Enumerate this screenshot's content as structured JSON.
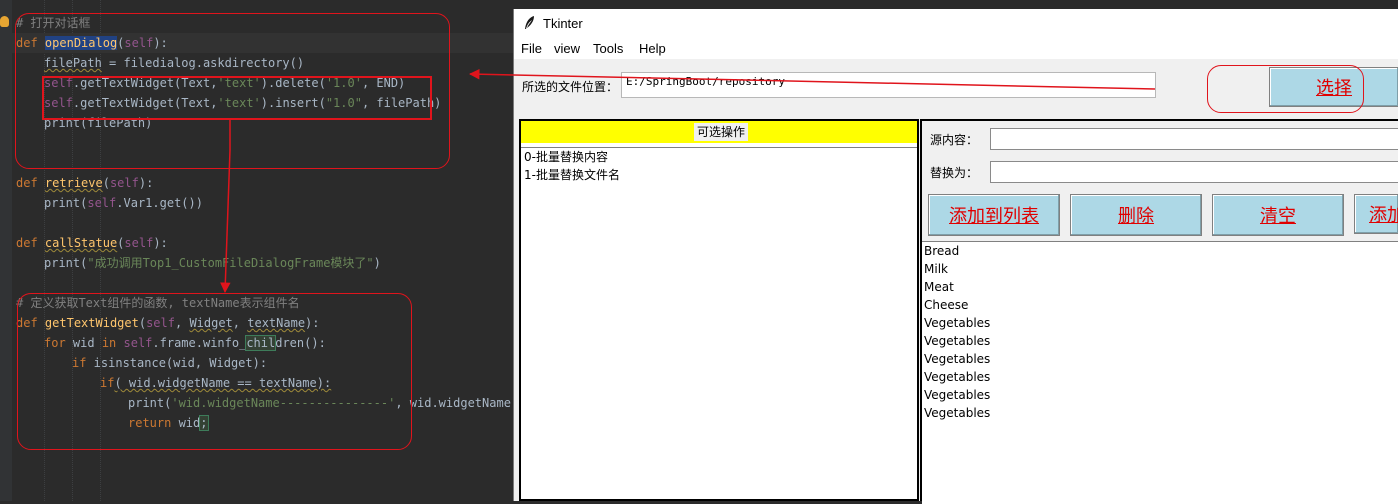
{
  "editor": {
    "lines": {
      "l1": "# 打开对话框",
      "l2_def": "def",
      "l2_name": "openDialog",
      "l2_self": "self",
      "l3_var": "filePath",
      "l3_rest": " = filedialog.askdirectory()",
      "l4_self": "self",
      "l4_a": ".getTextWidget(Text",
      "l4_str": "'text'",
      "l4_b": ").delete(",
      "l4_num": "'1.0'",
      "l4_c": ", END)",
      "l5_self": "self",
      "l5_a": ".getTextWidget(Text",
      "l5_str": "'text'",
      "l5_b": ").insert(",
      "l5_num": "\"1.0\"",
      "l5_c": ", filePath)",
      "l6": "print(filePath)",
      "l7_def": "def",
      "l7_name": "retrieve",
      "l7_self": "self",
      "l8_a": "print(",
      "l8_self": "self",
      "l8_b": ".Var1.get())",
      "l9_def": "def",
      "l9_name": "callStatue",
      "l9_self": "self",
      "l10_a": "print(",
      "l10_str": "\"成功调用Top1_CustomFileDialogFrame模块了\"",
      "l10_b": ")",
      "l11": "# 定义获取Text组件的函数, textName表示组件名",
      "l12_def": "def",
      "l12_name": "getTextWidget",
      "l12_self": "self",
      "l12_mid": ", ",
      "l12_widget": "Widget",
      "l12_sep": ", ",
      "l12_tn": "textName",
      "l12_end": "):",
      "l13_for": "for",
      "l13_a": " wid ",
      "l13_in": "in",
      "l13_self": "self",
      "l13_b": ".frame.winfo_",
      "l13_sel": "chil",
      "l13_c": "dren():",
      "l14_if": "if",
      "l14_a": " isinstance(wid, Widget):",
      "l15_if": "if",
      "l15_a": "( wid.widgetName == textName):",
      "l16_a": "print(",
      "l16_str": "'wid.widgetName---------------'",
      "l16_b": ", wid.widgetName)",
      "l17_ret": "return",
      "l17_a": " wid",
      "l17_semi": ";"
    }
  },
  "tk": {
    "title": "Tkinter",
    "menu": [
      "File",
      "view",
      "Tools",
      "Help"
    ],
    "path_label": "所选的文件位置：",
    "path_value": "E:/SpringBoot/repository",
    "choose_label": "选择",
    "ops_header": "可选操作",
    "ops_items": [
      "0-批量替换内容",
      "1-批量替换文件名"
    ],
    "source_label": "源内容：",
    "replace_label": "替换为：",
    "buttons": [
      "添加到列表",
      "删除",
      "清空",
      "添加"
    ],
    "items": [
      "Bread",
      "Milk",
      "Meat",
      "Cheese",
      "Vegetables",
      "Vegetables",
      "Vegetables",
      "Vegetables",
      "Vegetables",
      "Vegetables"
    ]
  },
  "colors": {
    "annotation": "#e0141c",
    "button_bg": "#add8e6",
    "button_text": "#e00000",
    "header_yellow": "#ffff00"
  }
}
